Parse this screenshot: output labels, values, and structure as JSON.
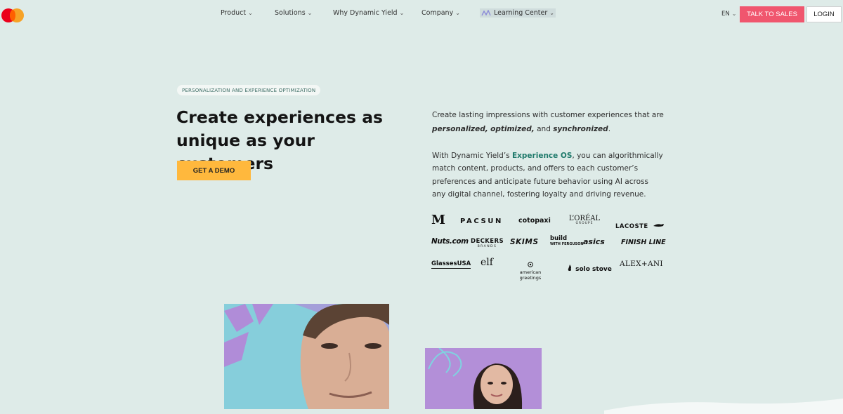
{
  "nav": {
    "items": [
      {
        "label": "Product"
      },
      {
        "label": "Solutions"
      },
      {
        "label": "Why Dynamic Yield"
      },
      {
        "label": "Company"
      },
      {
        "label": "Learning Center"
      }
    ],
    "lang": "EN",
    "talk_to_sales": "TALK TO SALES",
    "login": "LOGIN",
    "icons": {
      "logo": "mastercard-logo",
      "chevron": "chevron-down-icon",
      "learning": "learning-center-icon"
    }
  },
  "hero": {
    "badge": "PERSONALIZATION AND EXPERIENCE OPTIMIZATION",
    "headline_line1": "Create experiences as",
    "headline_line2": "unique as your customers",
    "cta": "GET A DEMO",
    "intro_pre": "Create lasting impressions with customer experiences that are ",
    "intro_personalized": "personalized,",
    "intro_optimized": "optimized,",
    "intro_and": " and ",
    "intro_synchronized": "synchronized",
    "intro_end": ".",
    "body_pre": "With Dynamic Yield’s ",
    "body_link": "Experience OS",
    "body_post": ", you can algorithmically match content, products, and offers to each customer’s preferences and anticipate future behavior using AI across any digital channel, fostering loyalty and driving revenue."
  },
  "logos": {
    "row1": [
      "M",
      "PACSUN",
      "cotopaxi",
      "L’ORÉAL",
      "LACOSTE"
    ],
    "loreal_sub": "GROUPE",
    "row2": [
      "Nuts.com",
      "DECKERS",
      "SKIMS",
      "build",
      "asics",
      "FINISH LINE"
    ],
    "deckers_sub": "BRANDS",
    "build_sub": "WITH FERGUSON",
    "row3": [
      "GlassesUSA",
      "elf",
      "american greetings",
      "solo stove",
      "ALEX+ANI"
    ]
  },
  "colors": {
    "background": "#deebe8",
    "talk_button": "#f0566e",
    "demo_button": "#ffb83d",
    "link": "#1f7a6b"
  }
}
